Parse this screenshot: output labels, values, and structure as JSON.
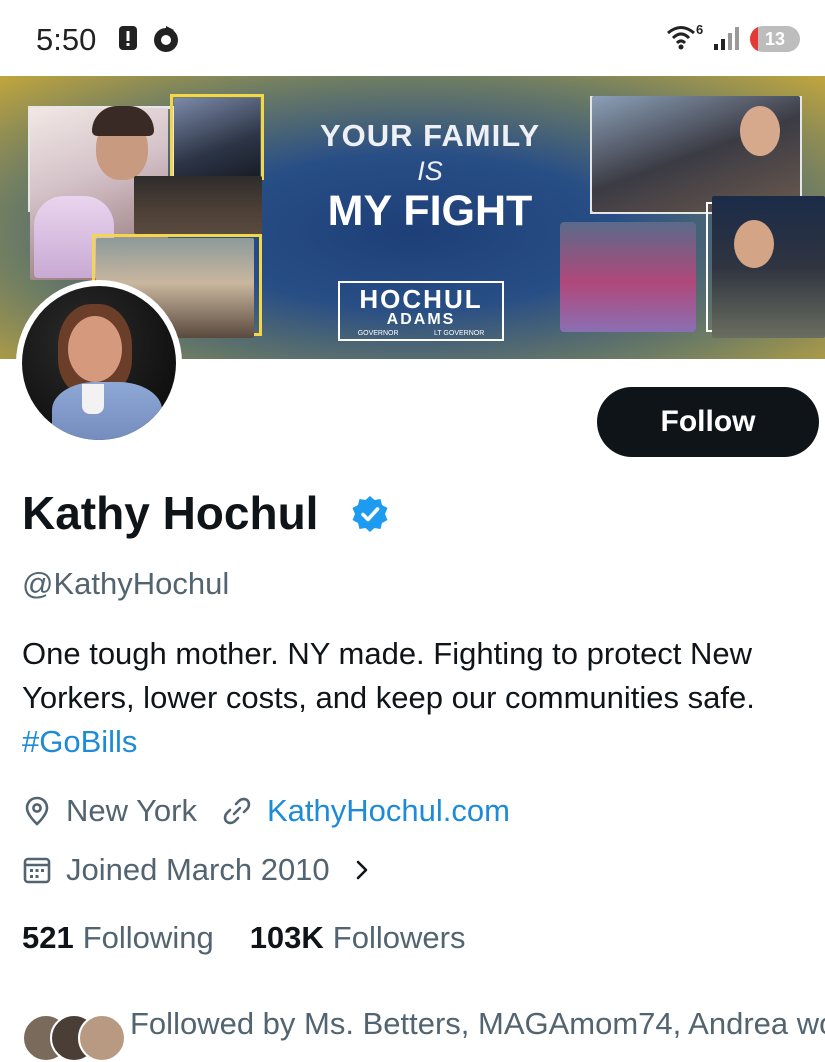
{
  "status_bar": {
    "time": "5:50",
    "wifi_badge": "6",
    "battery": "13"
  },
  "banner": {
    "line1": "YOUR FAMILY",
    "line2": "IS",
    "line3": "MY FIGHT",
    "logo_top": "HOCHUL",
    "logo_bottom": "ADAMS",
    "logo_left": "GOVERNOR",
    "logo_right": "LT GOVERNOR"
  },
  "actions": {
    "follow_label": "Follow"
  },
  "profile": {
    "name": "Kathy Hochul",
    "handle": "@KathyHochul",
    "bio_text": "One tough mother. NY made. Fighting to protect New Yorkers, lower costs, and keep our communities safe. ",
    "bio_hashtag": "#GoBills",
    "location": "New York",
    "website": "KathyHochul.com",
    "joined": "Joined March 2010"
  },
  "stats": {
    "following_count": "521",
    "following_label": "Following",
    "followers_count": "103K",
    "followers_label": "Followers"
  },
  "followed_by": "Followed by Ms. Betters, MAGAmom74, Andrea wo",
  "colors": {
    "accent": "#1d8bd8",
    "text_primary": "#0f1419",
    "text_secondary": "#536471",
    "verified": "#1d9bf0"
  }
}
